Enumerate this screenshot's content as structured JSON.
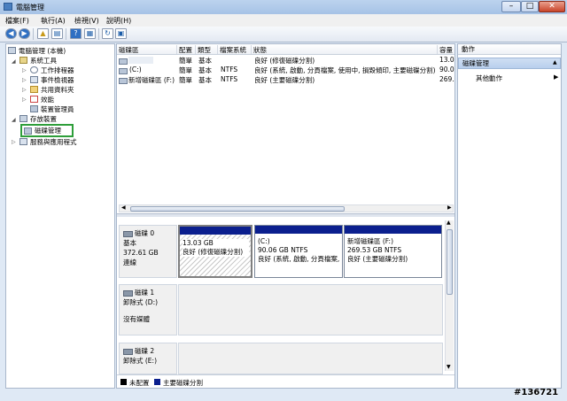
{
  "window": {
    "title": "電腦管理"
  },
  "menu": [
    "檔案(F)",
    "執行(A)",
    "檢視(V)",
    "說明(H)"
  ],
  "tree": {
    "root": "電腦管理 (本機)",
    "system_tools": "系統工具",
    "task_scheduler": "工作排程器",
    "event_viewer": "事件檢視器",
    "shared_folders": "共用資料夾",
    "performance": "效能",
    "device_manager": "裝置管理員",
    "storage": "存放裝置",
    "disk_management": "磁碟管理",
    "services": "服務與應用程式"
  },
  "list": {
    "columns": [
      "磁碟區",
      "配置",
      "類型",
      "檔案系統",
      "狀態",
      "容量"
    ],
    "rows": [
      {
        "volume": "",
        "layout": "簡單",
        "type": "基本",
        "fs": "",
        "status": "良好 (修復磁碟分割)",
        "capacity": "13.0"
      },
      {
        "volume": "(C:)",
        "layout": "簡單",
        "type": "基本",
        "fs": "NTFS",
        "status": "良好 (系統, 啟動, 分頁檔案, 使用中, 損毀傾印, 主要磁碟分割)",
        "capacity": "90.0"
      },
      {
        "volume": "新增磁碟區 (F:)",
        "layout": "簡單",
        "type": "基本",
        "fs": "NTFS",
        "status": "良好 (主要磁碟分割)",
        "capacity": "269."
      }
    ]
  },
  "disks": [
    {
      "name": "磁碟 0",
      "kind": "基本",
      "size": "372.61 GB",
      "state": "連線",
      "partitions": [
        {
          "title": "",
          "size": "13.03 GB",
          "status": "良好 (修復磁碟分割)"
        },
        {
          "title": "(C:)",
          "size": "90.06 GB NTFS",
          "status": "良好 (系統, 啟動, 分頁檔案,..."
        },
        {
          "title": "新增磁碟區 (F:)",
          "size": "269.53 GB NTFS",
          "status": "良好 (主要磁碟分割)"
        }
      ]
    },
    {
      "name": "磁碟 1",
      "kind": "卸除式 (D:)",
      "size": "",
      "state": "沒有媒體"
    },
    {
      "name": "磁碟 2",
      "kind": "卸除式 (E:)",
      "size": "",
      "state": ""
    }
  ],
  "legend": {
    "unallocated": "未配置",
    "primary": "主要磁碟分割",
    "unallocated_color": "#000000",
    "primary_color": "#0b1f8e"
  },
  "actions": {
    "header": "動作",
    "section": "磁碟管理",
    "more": "其他動作"
  },
  "watermark": "#136721",
  "colors": {
    "highlight": "#2e9e3a",
    "partition_bar": "#0b1f8e"
  }
}
